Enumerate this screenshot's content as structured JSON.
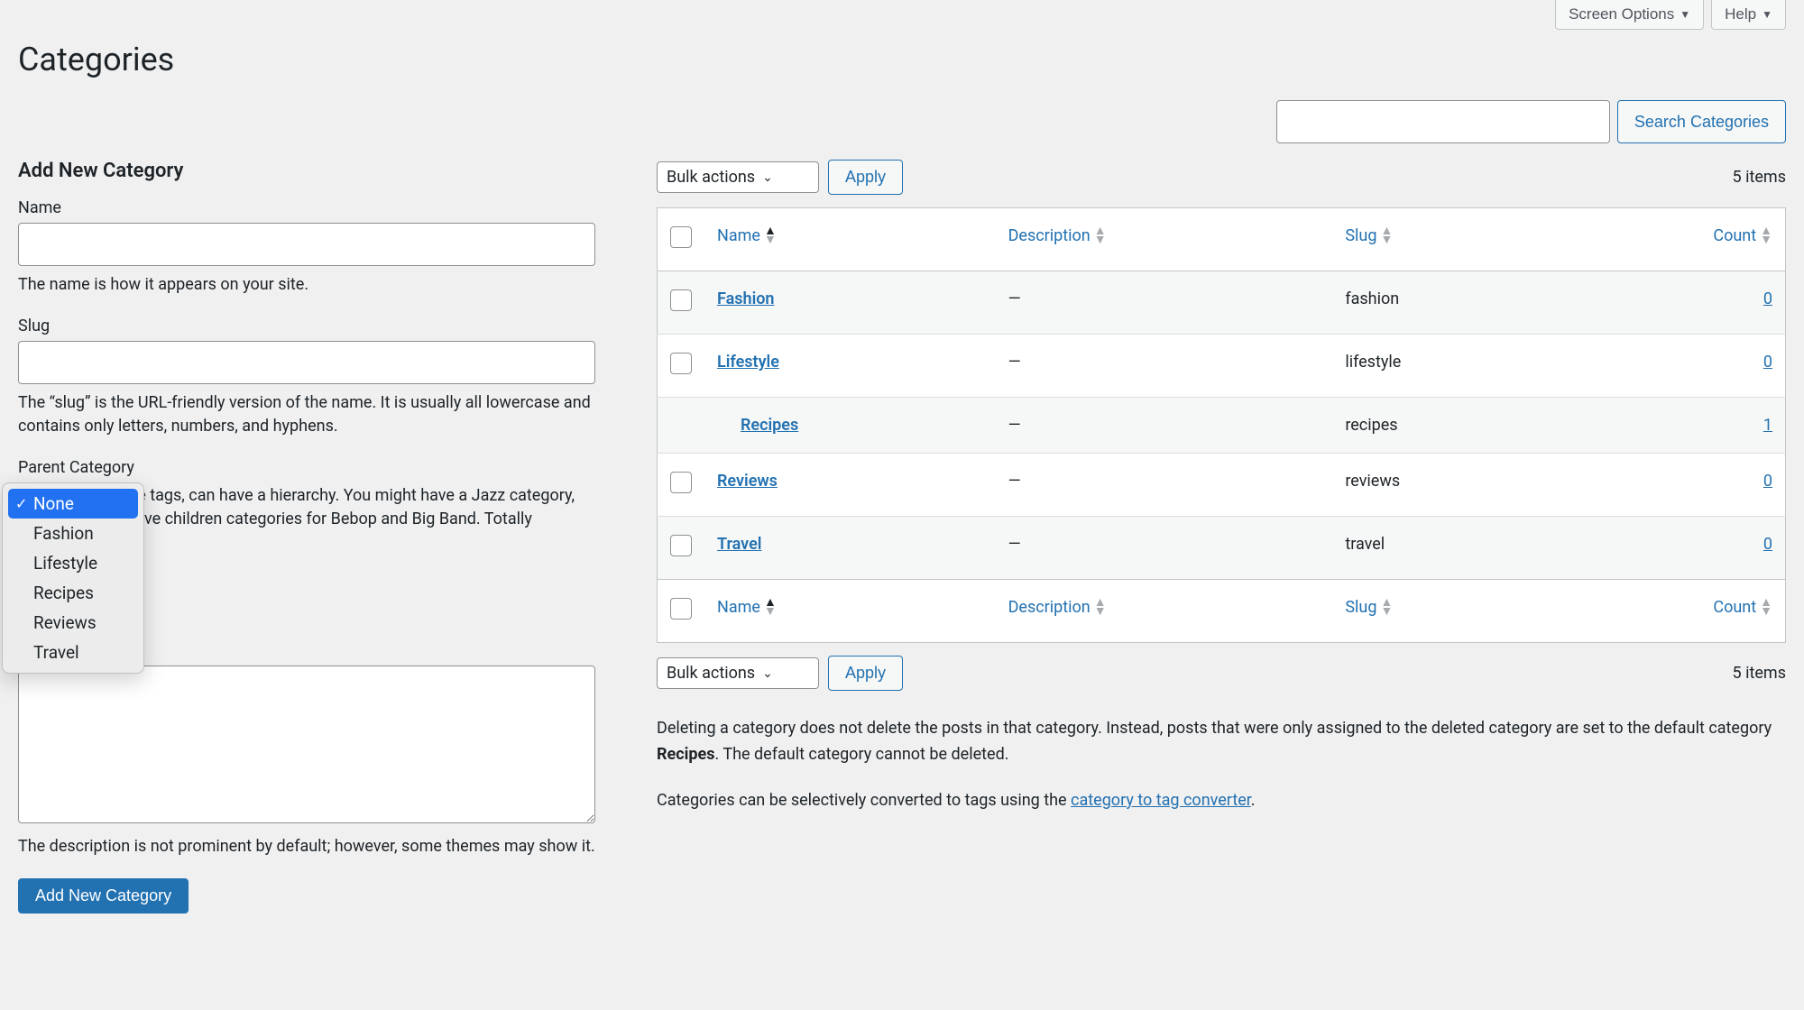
{
  "topbar": {
    "screen_options": "Screen Options",
    "help": "Help"
  },
  "page_title": "Categories",
  "search": {
    "button": "Search Categories"
  },
  "form": {
    "title": "Add New Category",
    "name_label": "Name",
    "name_help": "The name is how it appears on your site.",
    "slug_label": "Slug",
    "slug_help": "The “slug” is the URL-friendly version of the name. It is usually all lowercase and contains only letters, numbers, and hyphens.",
    "parent_label": "Parent Category",
    "parent_help": "Categories, unlike tags, can have a hierarchy. You might have a Jazz category, and under that have children categories for Bebop and Big Band. Totally optional.",
    "desc_help": "The description is not prominent by default; however, some themes may show it.",
    "submit": "Add New Category"
  },
  "dropdown": {
    "items": [
      {
        "label": "None",
        "selected": true
      },
      {
        "label": "Fashion",
        "selected": false
      },
      {
        "label": "Lifestyle",
        "selected": false
      },
      {
        "label": "Recipes",
        "selected": false
      },
      {
        "label": "Reviews",
        "selected": false
      },
      {
        "label": "Travel",
        "selected": false
      }
    ]
  },
  "bulk": {
    "label": "Bulk actions",
    "apply": "Apply"
  },
  "item_count": "5 items",
  "columns": {
    "name": "Name",
    "description": "Description",
    "slug": "Slug",
    "count": "Count"
  },
  "rows": [
    {
      "name": "Fashion",
      "desc": "—",
      "slug": "fashion",
      "count": "0",
      "indent": false
    },
    {
      "name": "Lifestyle",
      "desc": "—",
      "slug": "lifestyle",
      "count": "0",
      "indent": false
    },
    {
      "name": "Recipes",
      "desc": "—",
      "slug": "recipes",
      "count": "1",
      "indent": true
    },
    {
      "name": "Reviews",
      "desc": "—",
      "slug": "reviews",
      "count": "0",
      "indent": false
    },
    {
      "name": "Travel",
      "desc": "—",
      "slug": "travel",
      "count": "0",
      "indent": false
    }
  ],
  "footer_note": {
    "text1": "Deleting a category does not delete the posts in that category. Instead, posts that were only assigned to the deleted category are set to the default category ",
    "bold": "Recipes",
    "text2": ". The default category cannot be deleted.",
    "text3": "Categories can be selectively converted to tags using the ",
    "link": "category to tag converter",
    "text4": "."
  }
}
